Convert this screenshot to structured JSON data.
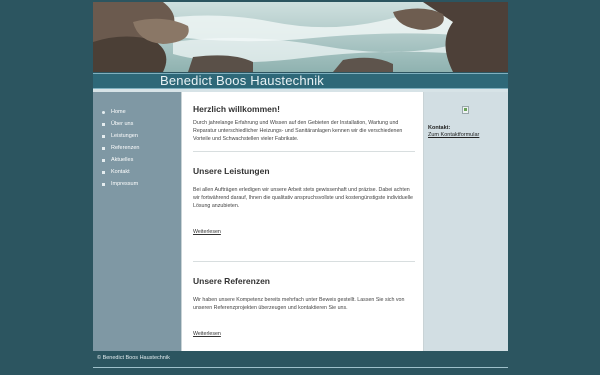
{
  "header": {
    "site_title": "Benedict Boos Haustechnik"
  },
  "sidebar": {
    "items": [
      {
        "label": "Home"
      },
      {
        "label": "Über uns"
      },
      {
        "label": "Leistungen"
      },
      {
        "label": "Referenzen"
      },
      {
        "label": "Aktuelles"
      },
      {
        "label": "Kontakt"
      },
      {
        "label": "Impressum"
      }
    ]
  },
  "main": {
    "welcome": {
      "heading": "Herzlich willkommen!",
      "text": "Durch jahrelange Erfahrung und Wissen auf den Gebieten der Installation, Wartung und Reparatur unterschiedlicher Heizungs- und Sanitäranlagen kennen wir die verschiedenen Vorteile und Schwachstellen vieler Fabrikate."
    },
    "services": {
      "heading": "Unsere Leistungen",
      "text": "Bei allen Aufträgen erledigen wir unsere Arbeit stets gewissenhaft und präzise. Dabei achten wir fortwährend darauf, Ihnen die qualitativ anspruchsvollste und kostengünstigste individuelle Lösung anzubieten.",
      "more_link": "Weiterlesen"
    },
    "references": {
      "heading": "Unsere Referenzen",
      "text": "Wir haben unsere Kompetenz bereits mehrfach unter Beweis gestellt. Lassen Sie sich von unseren Referenzprojekten überzeugen und kontaktieren Sie uns.",
      "more_link": "Weiterlesen"
    }
  },
  "rightcol": {
    "contact_label": "Kontakt:",
    "contact_link": "Zum Kontaktformular"
  },
  "footer": {
    "copyright": "© Benedict Boos Haustechnik"
  }
}
